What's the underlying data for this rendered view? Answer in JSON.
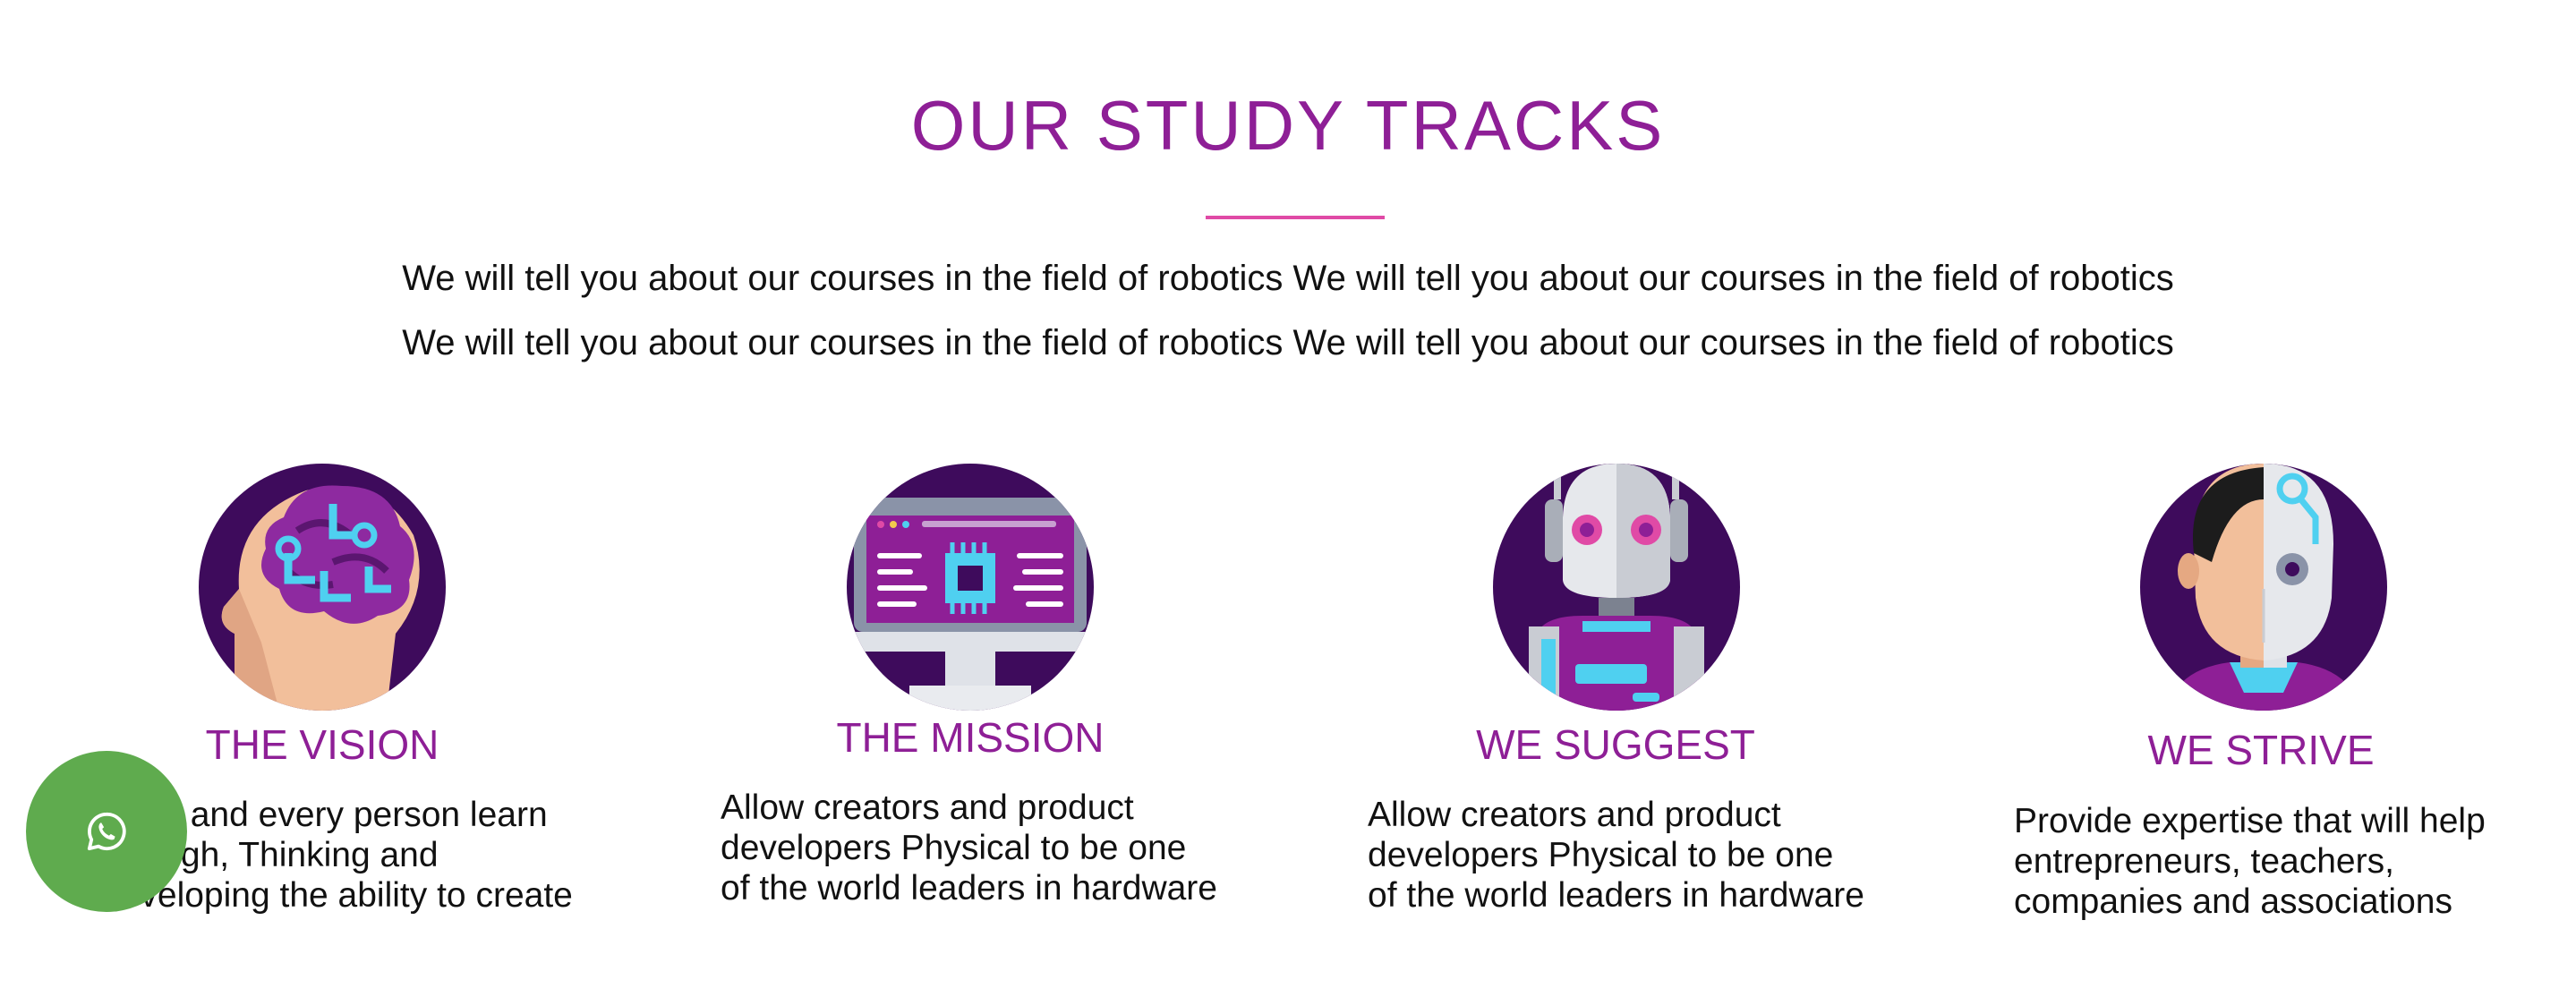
{
  "section": {
    "title": "OUR STUDY TRACKS",
    "intro_line_1": "We will tell you about our courses in the field of robotics We will tell you about our courses in the field of robotics",
    "intro_line_2": "We will tell you about our courses in the field of robotics We will tell you about our courses in the field of robotics"
  },
  "tracks": [
    {
      "icon": "brain-circuit-icon",
      "title": "THE VISION",
      "description": "Each and every person learn through, Thinking and developing the ability to create solutions"
    },
    {
      "icon": "computer-chip-monitor-icon",
      "title": "THE MISSION",
      "description": "Allow creators and product developers Physical to be one of the world leaders in hardware development"
    },
    {
      "icon": "robot-icon",
      "title": "WE SUGGEST",
      "description": "Allow creators and product developers Physical to be one of the world leaders in hardware development"
    },
    {
      "icon": "cyborg-face-icon",
      "title": "WE STRIVE",
      "description": "Provide expertise that will help entrepreneurs, teachers, companies and associations"
    }
  ],
  "whatsapp": {
    "icon": "whatsapp-icon"
  },
  "colors": {
    "accent_purple": "#8e1f96",
    "underline_pink": "#e04aa6",
    "icon_bg": "#3e0b5c",
    "whatsapp_green": "#5fab4e"
  }
}
